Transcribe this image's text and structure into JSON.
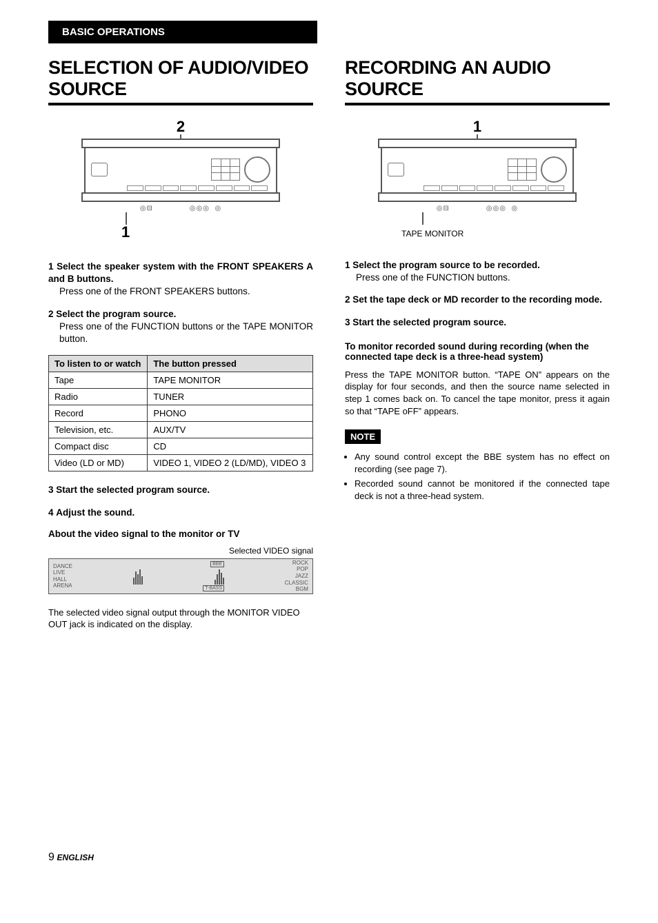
{
  "header": {
    "section": "BASIC OPERATIONS"
  },
  "left": {
    "title": "SELECTION OF AUDIO/VIDEO SOURCE",
    "diagram": {
      "top_label": "2",
      "bottom_label": "1"
    },
    "steps": {
      "s1": {
        "num": "1",
        "title": "Select the speaker system with the FRONT SPEAKERS A and B buttons.",
        "body": "Press one of the FRONT SPEAKERS buttons."
      },
      "s2": {
        "num": "2",
        "title": "Select the program source.",
        "body": "Press one of the FUNCTION buttons or the TAPE MONITOR button."
      },
      "s3": {
        "num": "3",
        "title": "Start the selected program source."
      },
      "s4": {
        "num": "4",
        "title": "Adjust the sound."
      }
    },
    "table": {
      "h1": "To listen to or watch",
      "h2": "The button pressed",
      "r1c1": "Tape",
      "r1c2": "TAPE MONITOR",
      "r2c1": "Radio",
      "r2c2": "TUNER",
      "r3c1": "Record",
      "r3c2": "PHONO",
      "r4c1": "Television, etc.",
      "r4c2": "AUX/TV",
      "r5c1": "Compact disc",
      "r5c2": "CD",
      "r6c1": "Video (LD or MD)",
      "r6c2": "VIDEO 1, VIDEO 2 (LD/MD), VIDEO 3"
    },
    "video_section": {
      "heading": "About the video signal to the monitor or TV",
      "lcd_label": "Selected VIDEO signal",
      "lcd_left": "DANCE\nLIVE\nHALL\nARENA",
      "lcd_right": "ROCK\nPOP\nJAZZ\nCLASSIC\nBGM",
      "lcd_bbe": "BBE",
      "lcd_tbass": "T-BASS",
      "caption": "The selected video signal output through the MONITOR VIDEO OUT jack is indicated on the display."
    }
  },
  "right": {
    "title": "RECORDING AN AUDIO SOURCE",
    "diagram": {
      "top_label": "1",
      "tape_label": "TAPE MONITOR"
    },
    "steps": {
      "s1": {
        "num": "1",
        "title": "Select the program source to be recorded.",
        "body": "Press one of the FUNCTION buttons."
      },
      "s2": {
        "num": "2",
        "title": "Set the tape deck or MD recorder to the recording mode."
      },
      "s3": {
        "num": "3",
        "title": "Start the selected program source."
      }
    },
    "monitor_heading": "To monitor recorded sound during recording (when the connected tape deck is a three-head system)",
    "monitor_body": "Press the TAPE MONITOR button. “TAPE ON” appears on the display for four seconds, and then the source name selected in step 1 comes back on. To cancel the tape monitor, press it again so that “TAPE oFF” appears.",
    "note_label": "NOTE",
    "note1": "Any sound control except the BBE system has no effect on recording (see page 7).",
    "note2": "Recorded sound cannot be monitored if the connected tape deck is not a three-head system."
  },
  "footer": {
    "page": "9",
    "lang": "ENGLISH"
  }
}
